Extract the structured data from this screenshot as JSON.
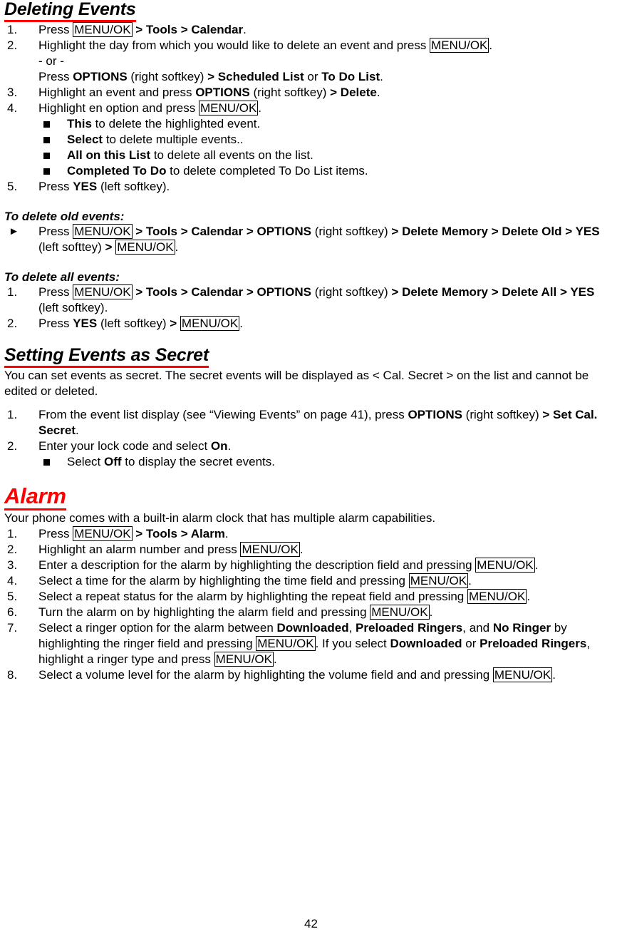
{
  "document": {
    "page_number": "42",
    "accent_color": "#ff0000"
  },
  "sections": {
    "deleting_events": {
      "heading": "Deleting Events",
      "steps": {
        "s1": {
          "num": "1.",
          "p1": "Press ",
          "key1": "MENU/OK",
          "gt1": " > ",
          "b1": "Tools",
          "gt2": " > ",
          "b2": "Calendar",
          "p2": "."
        },
        "s2": {
          "num": "2.",
          "p1": "Highlight the day from which you would like to delete an event and press ",
          "key1": "MENU/OK",
          "p2": ".",
          "or_line": "- or -",
          "l2p1": "Press ",
          "l2b1": "OPTIONS",
          "l2p2": " (right softkey) ",
          "l2gt": "> ",
          "l2b2": "Scheduled List",
          "l2p3": " or ",
          "l2b3": "To Do List",
          "l2p4": "."
        },
        "s3": {
          "num": "3.",
          "p1": "Highlight an event and press ",
          "b1": "OPTIONS",
          "p2": " (right softkey) ",
          "gt1": "> ",
          "b2": "Delete",
          "p3": "."
        },
        "s4": {
          "num": "4.",
          "p1": "Highlight en option and press ",
          "key1": "MENU/OK",
          "p2": ".",
          "bullets": [
            {
              "bold": "This",
              "rest": " to delete the highlighted event."
            },
            {
              "bold": "Select",
              "rest": " to delete multiple events.."
            },
            {
              "bold": "All on this List",
              "rest": " to delete all events on the list."
            },
            {
              "bold": "Completed To Do",
              "rest": " to delete completed To Do List items."
            }
          ]
        },
        "s5": {
          "num": "5.",
          "p1": "Press ",
          "b1": "YES",
          "p2": " (left softkey)."
        }
      }
    },
    "delete_old": {
      "heading": "To delete old events:",
      "marker": "►",
      "p1": "Press ",
      "key1": "MENU/OK",
      "gt1": " > ",
      "b1": "Tools",
      "gt2": " > ",
      "b2": "Calendar",
      "gt3": " > ",
      "b3": "OPTIONS",
      "p2": " (right softkey) ",
      "gt4": "> ",
      "b4": "Delete Memory",
      "gt5": " >",
      "b5": "Delete Old",
      "gt6": " > ",
      "b6": "YES",
      "p3": " (left softtey) ",
      "gt7": "> ",
      "key2": "MENU/OK",
      "p4": "."
    },
    "delete_all": {
      "heading": "To delete all events:",
      "s1": {
        "num": "1.",
        "p1": "Press ",
        "key1": "MENU/OK",
        "gt1": " > ",
        "b1": "Tools",
        "gt2": " > ",
        "b2": "Calendar",
        "gt3": " > ",
        "b3": "OPTIONS",
        "p2": " (right softkey) ",
        "gt4": "> ",
        "b4": "Delete Memory",
        "gt5": " >",
        "b5": "Delete All",
        "gt6": " > ",
        "b6": "YES",
        "p3": " (left softkey)."
      },
      "s2": {
        "num": "2.",
        "p1": "Press ",
        "b1": "YES",
        "p2": " (left softkey) ",
        "gt1": "> ",
        "key1": "MENU/OK",
        "p3": "."
      }
    },
    "setting_secret": {
      "heading": "Setting Events as Secret",
      "intro": "You can set events as secret. The secret events will be displayed as < Cal. Secret > on the list and cannot be edited or deleted.",
      "s1": {
        "num": "1.",
        "p1": "From the event list display (see “Viewing Events” on page 41), press ",
        "b1": "OPTIONS",
        "p2": " (right softkey) ",
        "gt1": "> ",
        "b2": "Set Cal. Secret",
        "p3": "."
      },
      "s2": {
        "num": "2.",
        "p1": "Enter your lock code and select ",
        "b1": "On",
        "p2": ".",
        "bullet": {
          "pre": "Select ",
          "bold": "Off",
          "rest": " to display the secret events."
        }
      }
    },
    "alarm": {
      "heading": "Alarm",
      "intro": "Your phone comes with a built-in alarm clock that has multiple alarm capabilities.",
      "s1": {
        "num": "1.",
        "p1": "Press ",
        "key1": "MENU/OK",
        "gt1": " > ",
        "b1": "Tools",
        "gt2": " > ",
        "b2": "Alarm",
        "p2": "."
      },
      "s2": {
        "num": "2.",
        "p1": "Highlight an alarm number and press ",
        "key1": "MENU/OK",
        "p2": "."
      },
      "s3": {
        "num": "3.",
        "p1": "Enter a description for the alarm by highlighting the description field and pressing ",
        "key1": "MENU/OK",
        "p2": "."
      },
      "s4": {
        "num": "4.",
        "p1": "Select a time for the alarm by highlighting the time field and pressing ",
        "key1": "MENU/OK",
        "p2": "."
      },
      "s5": {
        "num": "5.",
        "p1": "Select a repeat status for the alarm by highlighting the repeat field and pressing ",
        "key1": "MENU/OK",
        "p2": "."
      },
      "s6": {
        "num": "6.",
        "p1": "Turn the alarm on by highlighting the alarm field and pressing ",
        "key1": "MENU/OK",
        "p2": "."
      },
      "s7": {
        "num": "7.",
        "p1": "Select a ringer option for the alarm between ",
        "b1": "Downloaded",
        "p2": ", ",
        "b2": "Preloaded Ringers",
        "p3": ", and ",
        "b3": "No Ringer",
        "p4": " by highlighting the ringer field and pressing ",
        "key1": "MENU/OK",
        "p5": ". If you select ",
        "b4": "Downloaded",
        "p6": " or ",
        "b5": "Preloaded Ringers",
        "p7": ", highlight a ringer type and press ",
        "key2": "MENU/OK",
        "p8": "."
      },
      "s8": {
        "num": "8.",
        "p1": "Select a volume level for the alarm by highlighting the volume field and and pressing ",
        "key1": "MENU/OK",
        "p2": "."
      }
    }
  }
}
